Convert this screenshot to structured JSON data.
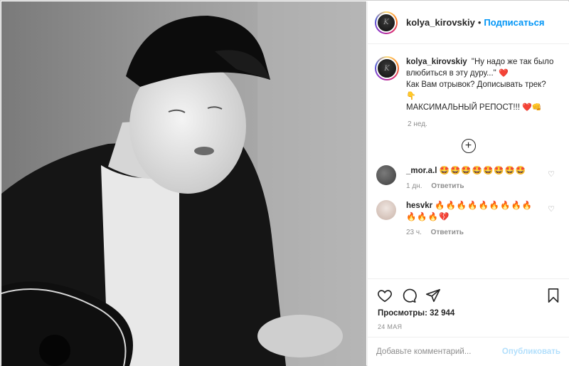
{
  "post": {
    "username": "kolya_kirovskiy",
    "separator": "•",
    "follow_label": "Подписаться",
    "avatar_text": "K"
  },
  "caption": {
    "username": "kolya_kirovskiy",
    "line1": "\"Ну надо же так было влюбиться в эту дуру...\"",
    "heart": "❤️",
    "line2": "Как Вам отрывок? Дописывать трек?",
    "point_emoji": "👇",
    "line3": "МАКСИМАЛЬНЫЙ РЕПОСТ!!!",
    "end_emojis": "❤️👊",
    "time": "2 нед."
  },
  "more_comments_label": "+",
  "comments": [
    {
      "username": "_mor.a.l",
      "text": "🤩🤩🤩🤩🤩🤩🤩🤩",
      "time": "1 дн.",
      "reply": "Ответить",
      "avatar_color": "#3d3d3d"
    },
    {
      "username": "hesvkr",
      "text": "🔥🔥🔥🔥🔥🔥🔥🔥🔥🔥🔥🔥💔",
      "time": "23 ч.",
      "reply": "Ответить",
      "avatar_color": "#d9c8c0"
    }
  ],
  "actions": {
    "like_icon": "heart-outline-icon",
    "comment_icon": "comment-bubble-icon",
    "share_icon": "paper-plane-icon",
    "save_icon": "bookmark-icon",
    "views_label": "Просмотры: 32 944",
    "date": "24 МАЯ"
  },
  "add_comment": {
    "placeholder": "Добавьте комментарий...",
    "publish_label": "Опубликовать"
  },
  "colors": {
    "accent": "#0095f6",
    "publish_disabled": "#b2dffc",
    "muted": "#8e8e8e",
    "text": "#262626",
    "like_red": "#ed4956"
  }
}
